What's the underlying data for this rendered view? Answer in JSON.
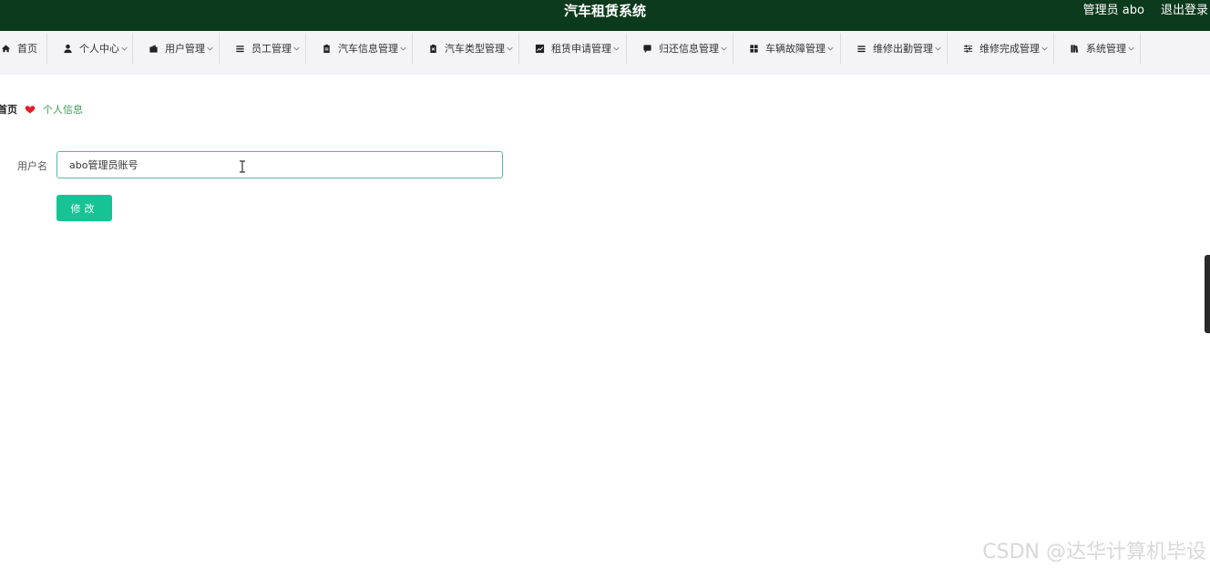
{
  "header": {
    "title": "汽车租赁系统",
    "user_label": "管理员 abo",
    "logout_label": "退出登录"
  },
  "nav": {
    "items": [
      {
        "label": "首页",
        "icon": "home-icon",
        "dropdown": false
      },
      {
        "label": "个人中心",
        "icon": "user-icon",
        "dropdown": true
      },
      {
        "label": "用户管理",
        "icon": "wallet-icon",
        "dropdown": true
      },
      {
        "label": "员工管理",
        "icon": "list-icon",
        "dropdown": true
      },
      {
        "label": "汽车信息管理",
        "icon": "clipboard-icon",
        "dropdown": true
      },
      {
        "label": "汽车类型管理",
        "icon": "clipboard-x-icon",
        "dropdown": true
      },
      {
        "label": "租赁申请管理",
        "icon": "chart-line-icon",
        "dropdown": true
      },
      {
        "label": "归还信息管理",
        "icon": "chat-icon",
        "dropdown": true
      },
      {
        "label": "车辆故障管理",
        "icon": "grid-icon",
        "dropdown": true
      },
      {
        "label": "维修出勤管理",
        "icon": "list-icon",
        "dropdown": true
      },
      {
        "label": "维修完成管理",
        "icon": "sliders-icon",
        "dropdown": true
      },
      {
        "label": "系统管理",
        "icon": "book-icon",
        "dropdown": true
      }
    ]
  },
  "breadcrumb": {
    "home": "首页",
    "separator_icon": "heart-icon",
    "current": "个人信息"
  },
  "form": {
    "username_label": "用户名",
    "username_value": "abo管理员账号",
    "submit_label": "修改"
  },
  "watermark": "CSDN @达华计算机毕设",
  "colors": {
    "header_bg": "#0c3a1c",
    "nav_bg": "#f4f3f6",
    "accent": "#16c394",
    "input_border": "#57b7a6",
    "breadcrumb_current": "#3f9a5b",
    "heart": "#e0202a"
  }
}
